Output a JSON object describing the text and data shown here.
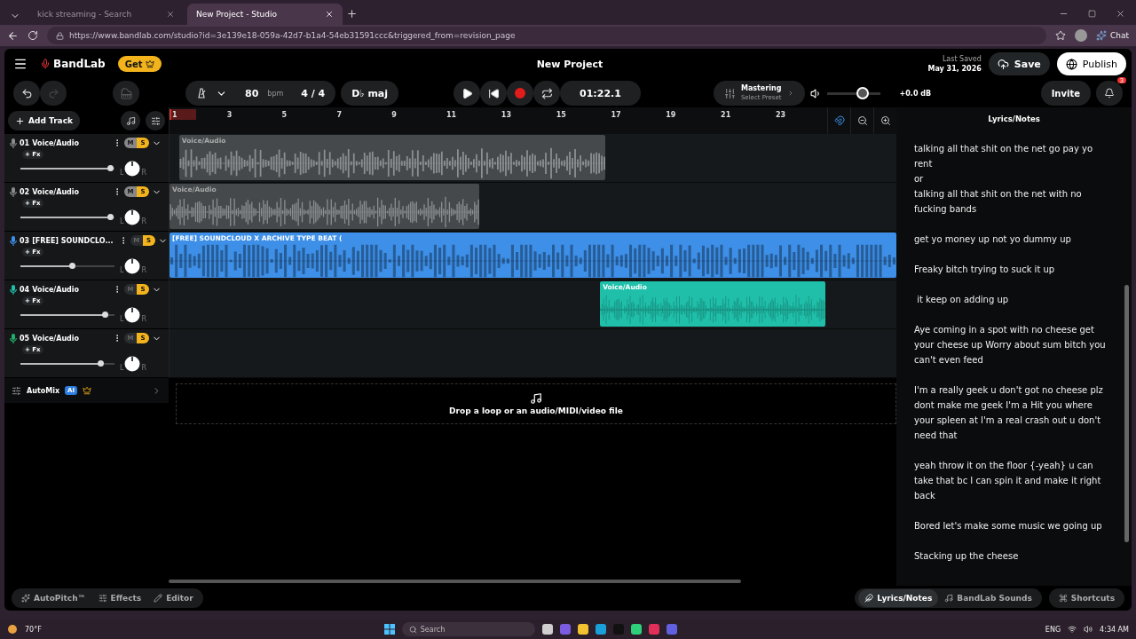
{
  "browser": {
    "tabs": [
      {
        "title": "kick streaming - Search",
        "selected": false
      },
      {
        "title": "New Project - Studio",
        "selected": true
      }
    ],
    "url": "https://www.bandlab.com/studio?id=3e139e18-059a-42d7-b1a4-54eb31591ccc&triggered_from=revision_page",
    "chat_label": "Chat"
  },
  "header": {
    "logo": "BandLab",
    "get_label": "Get",
    "project_title": "New Project",
    "last_saved_label": "Last Saved",
    "last_saved_date": "May 31, 2026",
    "save_label": "Save",
    "publish_label": "Publish"
  },
  "toolbar": {
    "tempo": "80",
    "tempo_unit": "bpm",
    "time_signature": "4 / 4",
    "key": "D♭ maj",
    "time": "01:22.1",
    "mastering_title": "Mastering",
    "mastering_preset": "Select Preset",
    "master_volume": {
      "level": 0.67
    },
    "master_db": "+0.0 dB",
    "invite_label": "Invite",
    "notification_count": "3"
  },
  "tracks_panel": {
    "add_track_label": "Add Track",
    "automix_label": "AutoMix",
    "automix_badge": "AI",
    "tracks": [
      {
        "number": "01",
        "name": "Voice/Audio",
        "fx_label": "+ Fx",
        "mute_label": "M",
        "solo_label": "S",
        "muted": true,
        "solo": true,
        "color": "#8a8a8a",
        "level": 0.95,
        "pan_left": "L",
        "pan_right": "R",
        "clip": {
          "label": "Voice/Audio"
        }
      },
      {
        "number": "02",
        "name": "Voice/Audio",
        "fx_label": "+ Fx",
        "mute_label": "M",
        "solo_label": "S",
        "muted": true,
        "solo": true,
        "color": "#8a8a8a",
        "level": 0.95,
        "pan_left": "L",
        "pan_right": "R",
        "clip": {
          "label": "Voice/Audio"
        }
      },
      {
        "number": "03",
        "name": "[FREE] SOUNDCLO...",
        "fx_label": "+ Fx",
        "mute_label": "M",
        "solo_label": "S",
        "muted": false,
        "solo": true,
        "color": "#3d8fe8",
        "level": 0.55,
        "pan_left": "L",
        "pan_right": "R",
        "clip": {
          "label": "[FREE] SOUNDCLOUD X ARCHIVE TYPE BEAT ("
        }
      },
      {
        "number": "04",
        "name": "Voice/Audio",
        "fx_label": "+ Fx",
        "mute_label": "M",
        "solo_label": "S",
        "muted": false,
        "solo": true,
        "color": "#1fbfa9",
        "level": 0.9,
        "pan_left": "L",
        "pan_right": "R",
        "clip": {
          "label": "Voice/Audio"
        }
      },
      {
        "number": "05",
        "name": "Voice/Audio",
        "fx_label": "+ Fx",
        "mute_label": "M",
        "solo_label": "S",
        "muted": false,
        "solo": true,
        "color": "#20b26b",
        "level": 0.85,
        "pan_left": "L",
        "pan_right": "R"
      }
    ]
  },
  "ruler": {
    "labels": [
      "1",
      "3",
      "5",
      "7",
      "9",
      "11",
      "13",
      "15",
      "17",
      "19",
      "21",
      "23"
    ]
  },
  "drop_zone": {
    "text": "Drop a loop or an audio/MIDI/video file"
  },
  "lyrics": {
    "title": "Lyrics/Notes",
    "paragraphs": [
      [
        "talking all that shit on the net go pay yo rent",
        "or",
        "talking all that shit on the net with no fucking bands"
      ],
      [
        "get yo money up not yo dummy up"
      ],
      [
        "Freaky bitch trying to suck it up"
      ],
      [
        " it keep on adding up"
      ],
      [
        "Aye coming in a spot with no cheese get your cheese up Worry about sum bitch you can't even feed"
      ],
      [
        "I'm a really geek u don't got no cheese plz dont make me geek I'm a Hit you where your spleen at I'm a real crash out u don't need that"
      ],
      [
        "yeah throw it on the floor {-yeah} u can take that bc I can spin it and make it right back"
      ],
      [
        "Bored let's make some music we going up"
      ],
      [
        "Stacking up the cheese"
      ]
    ]
  },
  "bottom_bar": {
    "left": [
      {
        "label": "AutoPitch™",
        "kind": "autopitch"
      },
      {
        "label": "Effects",
        "kind": "effects"
      },
      {
        "label": "Editor",
        "kind": "editor"
      }
    ],
    "right": [
      {
        "label": "Lyrics/Notes",
        "kind": "lyrics",
        "selected": true
      },
      {
        "label": "BandLab Sounds",
        "kind": "sounds",
        "selected": false
      },
      {
        "label": "Shortcuts",
        "kind": "shortcuts",
        "selected": false
      }
    ]
  },
  "taskbar": {
    "weather": "70°F",
    "search_placeholder": "Search",
    "language": "ENG",
    "time": "4:34 AM"
  }
}
